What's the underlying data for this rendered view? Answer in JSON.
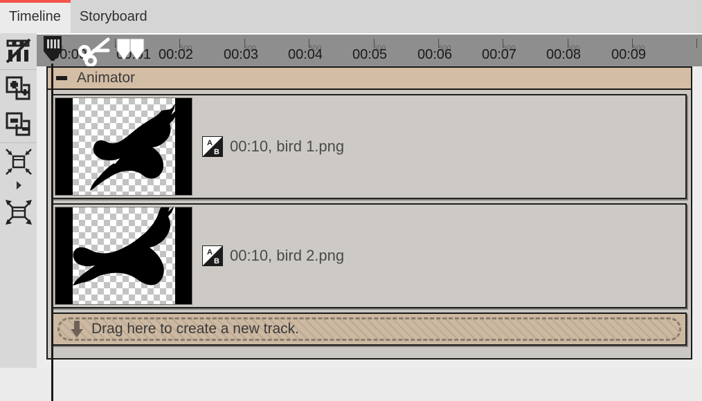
{
  "tabs": [
    {
      "label": "Timeline",
      "active": true,
      "accent": "#f4544b"
    },
    {
      "label": "Storyboard",
      "active": false
    }
  ],
  "toolbar": {
    "items": [
      {
        "name": "toggle-thumbnails-icon",
        "title": "Toggle thumbnails"
      },
      {
        "name": "add-track-icon",
        "title": "Add track"
      },
      {
        "name": "remove-track-icon",
        "title": "Remove track"
      },
      {
        "name": "zoom-timeline-out-icon",
        "title": "Zoom timeline out"
      },
      {
        "name": "zoom-dropdown-icon",
        "title": "Zoom options"
      },
      {
        "name": "zoom-timeline-in-icon",
        "title": "Zoom timeline in"
      }
    ]
  },
  "ruler": {
    "major_labels": [
      "00:00",
      "00:01",
      "00:02",
      "00:03",
      "00:04",
      "00:05",
      "00:06",
      "00:07",
      "00:08",
      "00:09"
    ],
    "sub_label": "500",
    "playhead_position": "00:00",
    "markers": [
      "in-point",
      "out-point"
    ],
    "cursor": "scissors-cursor"
  },
  "group": {
    "title": "Animator",
    "collapse_label": "—",
    "background_color": "#d3bda4"
  },
  "clips": [
    {
      "duration": "00:10",
      "filename": "bird 1.png",
      "label": "00:10, bird 1.png",
      "transition_icon": "ab-transition-icon",
      "thumbnail": "bird-1-thumbnail"
    },
    {
      "duration": "00:10",
      "filename": "bird 2.png",
      "label": "00:10, bird 2.png",
      "transition_icon": "ab-transition-icon",
      "thumbnail": "bird-2-thumbnail"
    }
  ],
  "drop_zone": {
    "label": "Drag here to create a new track.",
    "icon": "down-arrow-icon"
  }
}
